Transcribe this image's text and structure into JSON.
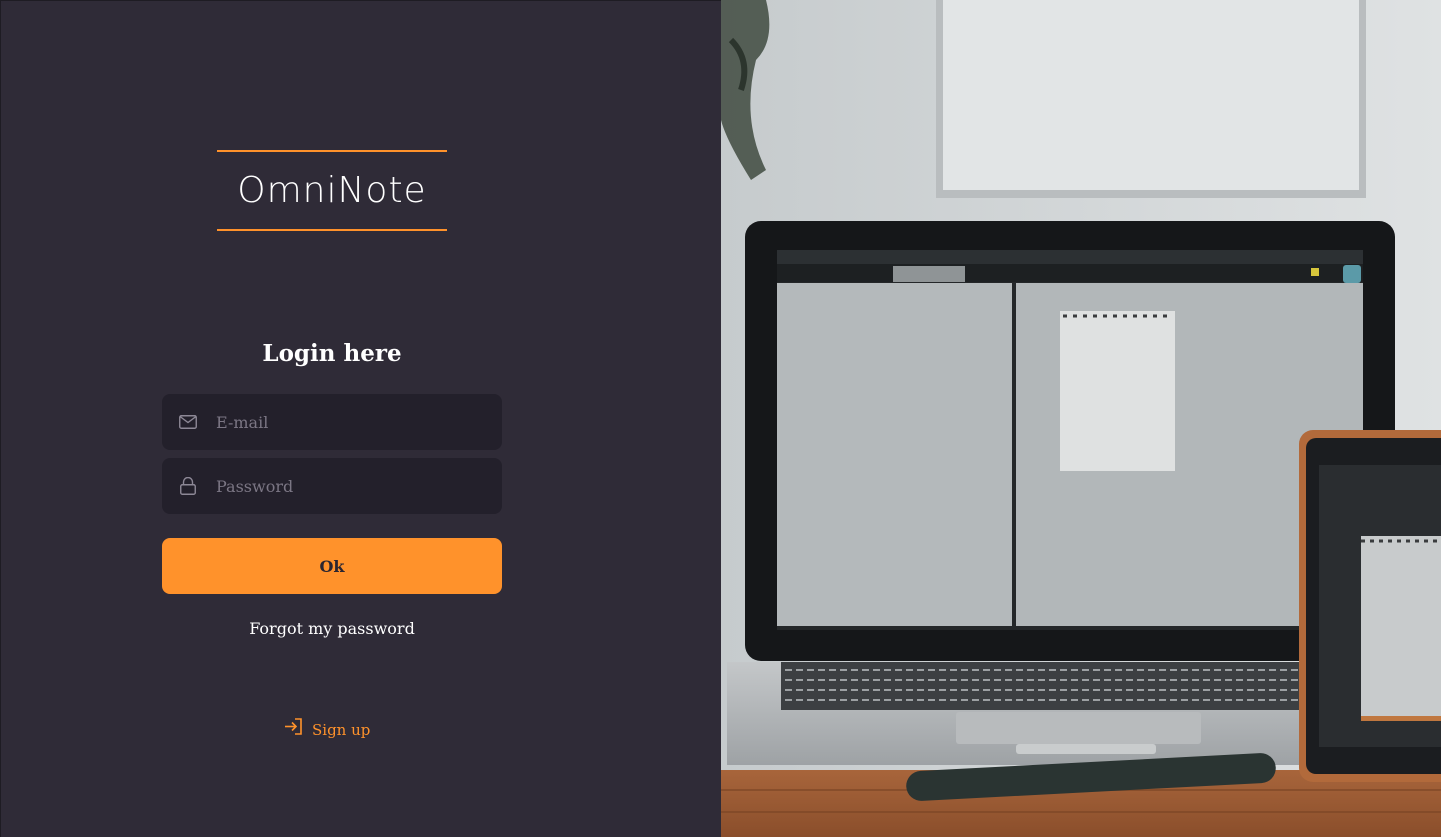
{
  "brand": {
    "name": "OmniNote"
  },
  "login": {
    "title": "Login here",
    "email_placeholder": "E-mail",
    "password_placeholder": "Password",
    "submit_label": "Ok",
    "forgot_label": "Forgot my password",
    "signup_label": "Sign up"
  },
  "icons": {
    "email": "mail-icon",
    "password": "lock-icon",
    "signup": "sign-in-icon"
  },
  "colors": {
    "accent": "#ff922b",
    "panel": "#2f2b37",
    "field": "#23202b"
  }
}
